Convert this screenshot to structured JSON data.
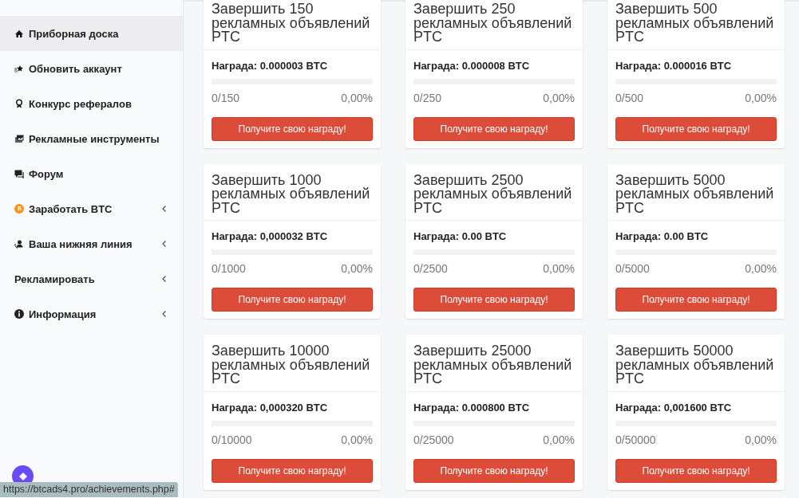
{
  "sidebar": {
    "items": [
      {
        "label": "Приборная доска",
        "selected": true,
        "expandable": false
      },
      {
        "label": "Обновить аккаунт",
        "selected": false,
        "expandable": false
      },
      {
        "label": "Конкурс рефералов",
        "selected": false,
        "expandable": false
      },
      {
        "label": "Рекламные инструменты",
        "selected": false,
        "expandable": false
      },
      {
        "label": "Форум",
        "selected": false,
        "expandable": false
      },
      {
        "label": "Заработать BTC",
        "selected": false,
        "expandable": true
      },
      {
        "label": "Ваша нижняя линия",
        "selected": false,
        "expandable": true
      },
      {
        "label": "Рекламировать",
        "selected": false,
        "expandable": true
      },
      {
        "label": "Информация",
        "selected": false,
        "expandable": true
      }
    ]
  },
  "achievements": [
    {
      "title": "Завершить 150 рекламных объявлений PTC",
      "reward": "Награда: 0.000003 BTC",
      "level": 0,
      "count": "0/150",
      "percent": "0,00%",
      "button": "Получите свою награду!"
    },
    {
      "title": "Завершить 250 рекламных объявлений PTC",
      "reward": "Награда: 0.000008 BTC",
      "level": 0,
      "count": "0/250",
      "percent": "0,00%",
      "button": "Получите свою награду!"
    },
    {
      "title": "Завершить 500 рекламных объявлений PTC",
      "reward": "Награда: 0.000016 BTC",
      "level": 0,
      "count": "0/500",
      "percent": "0,00%",
      "button": "Получите свою награду!"
    },
    {
      "title": "Завершить 1000 рекламных объявлений PTC",
      "reward": "Награда: 0,000032 BTC",
      "level": 0,
      "count": "0/1000",
      "percent": "0,00%",
      "button": "Получите свою награду!"
    },
    {
      "title": "Завершить 2500 рекламных объявлений PTC",
      "reward": "Награда: 0.00 BTC",
      "level": 0,
      "count": "0/2500",
      "percent": "0,00%",
      "button": "Получите свою награду!"
    },
    {
      "title": "Завершить 5000 рекламных объявлений PTC",
      "reward": "Награда: 0.00 BTC",
      "level": 0,
      "count": "0/5000",
      "percent": "0,00%",
      "button": "Получите свою награду!"
    },
    {
      "title": "Завершить 10000 рекламных объявлений PTC",
      "reward": "Награда: 0,000320 BTC",
      "level": 0,
      "count": "0/10000",
      "percent": "0,00%",
      "button": "Получите свою награду!"
    },
    {
      "title": "Завершить 25000 рекламных объявлений PTC",
      "reward": "Награда: 0.000800 BTC",
      "level": 0,
      "count": "0/25000",
      "percent": "0,00%",
      "button": "Получите свою награду!"
    },
    {
      "title": "Завершить 50000 рекламных объявлений PTC",
      "reward": "Награда: 0,001600 BTC",
      "level": 0,
      "count": "0/50000",
      "percent": "0,00%",
      "button": "Получите свою награду!"
    }
  ],
  "status_bar": {
    "url": "https://btcads4.pro/achievements.php#"
  }
}
